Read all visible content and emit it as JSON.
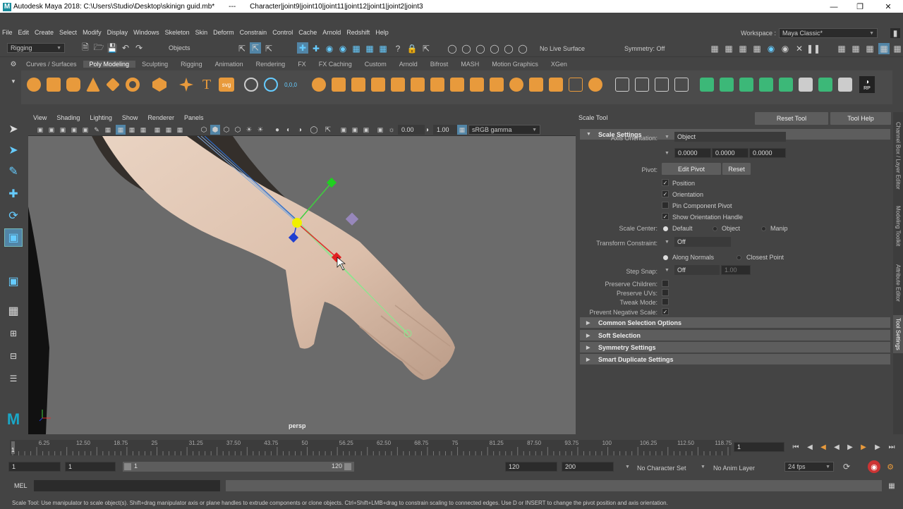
{
  "title": {
    "app": "Autodesk Maya 2018: C:\\Users\\Studio\\Desktop\\skinign guid.mb*",
    "sep": "---",
    "node": "Character|joint9|joint10|joint11|joint12|joint1|joint2|joint3"
  },
  "menus": [
    "File",
    "Edit",
    "Create",
    "Select",
    "Modify",
    "Display",
    "Windows",
    "Skeleton",
    "Skin",
    "Deform",
    "Constrain",
    "Control",
    "Cache",
    "Arnold",
    "Redshift",
    "Help"
  ],
  "workspace": {
    "label": "Workspace :",
    "value": "Maya Classic*"
  },
  "status": {
    "menuset": "Rigging",
    "select_mode": "Objects",
    "live_surface": "No Live Surface",
    "symmetry": "Symmetry: Off"
  },
  "shelf_tabs": [
    "Curves / Surfaces",
    "Poly Modeling",
    "Sculpting",
    "Rigging",
    "Animation",
    "Rendering",
    "FX",
    "FX Caching",
    "Custom",
    "Arnold",
    "Bifrost",
    "MASH",
    "Motion Graphics",
    "XGen"
  ],
  "shelf_active": "Poly Modeling",
  "shelf_rp_label": "RP",
  "viewport": {
    "menus": [
      "View",
      "Shading",
      "Lighting",
      "Show",
      "Renderer",
      "Panels"
    ],
    "exposure": "0.00",
    "gamma": "1.00",
    "colorspace": "sRGB gamma",
    "camera": "persp"
  },
  "tool_settings": {
    "title": "Scale Tool",
    "reset_tool": "Reset Tool",
    "tool_help": "Tool Help",
    "section": "Scale Settings",
    "axis_orientation_label": "Axis Orientation:",
    "axis_orientation": "Object",
    "axis_values": [
      "0.0000",
      "0.0000",
      "0.0000"
    ],
    "pivot_label": "Pivot:",
    "edit_pivot": "Edit Pivot",
    "reset": "Reset",
    "checks": [
      {
        "label": "Position",
        "checked": true
      },
      {
        "label": "Orientation",
        "checked": true
      },
      {
        "label": "Pin Component Pivot",
        "checked": false
      },
      {
        "label": "Show Orientation Handle",
        "checked": true
      }
    ],
    "scale_center_label": "Scale Center:",
    "scale_center": [
      "Default",
      "Object",
      "Manip"
    ],
    "transform_constraint_label": "Transform Constraint:",
    "transform_constraint": "Off",
    "along": [
      "Along Normals",
      "Closest Point"
    ],
    "step_snap_label": "Step Snap:",
    "step_snap": "Off",
    "step_snap_value": "1.00",
    "options": [
      {
        "label": "Preserve Children:",
        "checked": false
      },
      {
        "label": "Preserve UVs:",
        "checked": false
      },
      {
        "label": "Tweak Mode:",
        "checked": false
      },
      {
        "label": "Prevent Negative Scale:",
        "checked": true
      }
    ],
    "collapsed_sections": [
      "Common Selection Options",
      "Soft Selection",
      "Symmetry Settings",
      "Smart Duplicate Settings"
    ]
  },
  "side_tabs": [
    "Channel Box / Layer Editor",
    "Modeling Toolkit",
    "Attribute Editor",
    "Tool Settings"
  ],
  "timeline": {
    "ticks": [
      "6.25",
      "12.50",
      "18.75",
      "25",
      "31.25",
      "37.50",
      "43.75",
      "50",
      "56.25",
      "62.50",
      "68.75",
      "75",
      "81.25",
      "87.50",
      "93.75",
      "100",
      "106.25",
      "112.50",
      "118.75"
    ],
    "start_marker": "1",
    "current_frame": "1"
  },
  "range": {
    "start": "1",
    "playback_start": "1",
    "slider_start": "1",
    "slider_end": "120",
    "playback_end": "120",
    "end": "200",
    "character_set": "No Character Set",
    "anim_layer": "No Anim Layer",
    "fps": "24 fps"
  },
  "cmd": {
    "lang": "MEL"
  },
  "help_line": "Scale Tool: Use manipulator to scale object(s). Shift+drag manipulator axis or plane handles to extrude components or clone objects. Ctrl+Shift+LMB+drag to constrain scaling to connected edges. Use D or INSERT to change the pivot position and axis orientation."
}
